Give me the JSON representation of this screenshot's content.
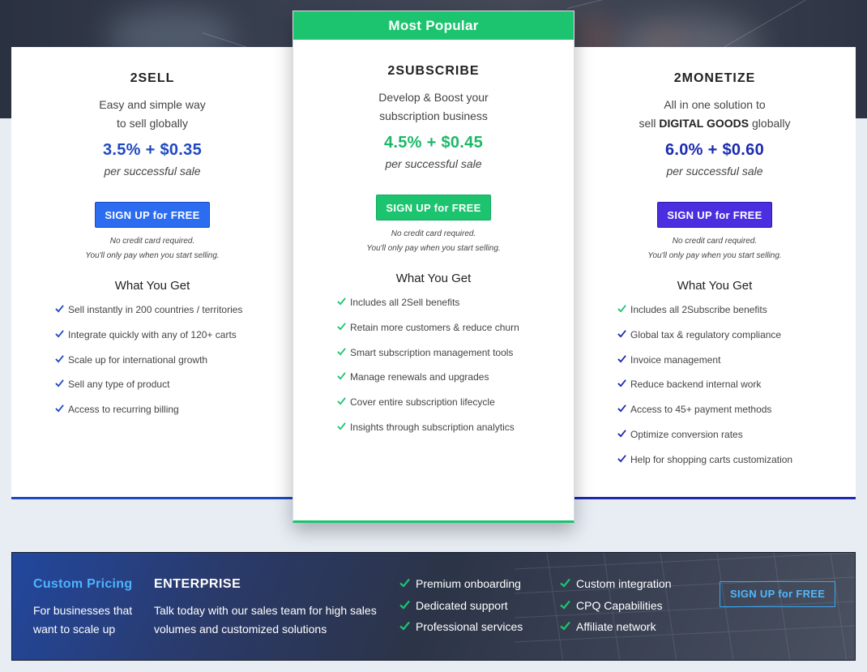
{
  "plans": [
    {
      "name": "2SELL",
      "tagline1": "Easy and simple way",
      "tagline2": "to sell globally",
      "price": "3.5% + $0.35",
      "per": "per successful sale",
      "button": "SIGN UP for FREE",
      "note1": "No credit card required.",
      "note2": "You'll only pay when you start selling.",
      "what_you_get": "What You Get",
      "features": [
        "Sell instantly in 200 countries / territories",
        "Integrate quickly with any of 120+ carts",
        "Scale up for international growth",
        "Sell any type of product",
        "Access to recurring billing"
      ]
    },
    {
      "badge": "Most Popular",
      "name": "2SUBSCRIBE",
      "tagline1": "Develop & Boost your",
      "tagline2": "subscription business",
      "price": "4.5% + $0.45",
      "per": "per successful sale",
      "button": "SIGN UP for FREE",
      "note1": "No credit card required.",
      "note2": "You'll only pay when you start selling.",
      "what_you_get": "What You Get",
      "features": [
        "Includes all 2Sell benefits",
        "Retain more customers & reduce churn",
        "Smart subscription management tools",
        "Manage renewals and upgrades",
        "Cover entire subscription lifecycle",
        "Insights through subscription analytics"
      ]
    },
    {
      "name": "2MONETIZE",
      "tagline1": "All in one solution to",
      "tagline2_pre": "sell ",
      "tagline2_bold": "DIGITAL GOODS",
      "tagline2_post": " globally",
      "price": "6.0% + $0.60",
      "per": "per successful sale",
      "button": "SIGN UP for FREE",
      "note1": "No credit card required.",
      "note2": "You'll only pay when you start selling.",
      "what_you_get": "What You Get",
      "features": [
        "Includes all 2Subscribe benefits",
        "Global tax & regulatory compliance",
        "Invoice management",
        "Reduce backend internal work",
        "Access to 45+ payment methods",
        "Optimize conversion rates",
        "Help for shopping carts customization"
      ]
    }
  ],
  "enterprise": {
    "custom_title": "Custom Pricing",
    "custom_desc": "For businesses that want to scale up",
    "title": "ENTERPRISE",
    "desc": "Talk today with our sales team for high sales volumes and customized solutions",
    "col1": [
      "Premium onboarding",
      "Dedicated support",
      "Professional services"
    ],
    "col2": [
      "Custom integration",
      "CPQ Capabilities",
      "Affiliate network"
    ],
    "button": "SIGN UP for FREE"
  },
  "colors": {
    "sell": "#1f49c2",
    "subscribe": "#1cc46f",
    "monetize": "#1c2bb0",
    "monetize_button": "#4a2ee0",
    "sell_button": "#2b6cf0",
    "enterprise_accent": "#4fb3ff"
  },
  "icons": {
    "check": "check-icon"
  }
}
